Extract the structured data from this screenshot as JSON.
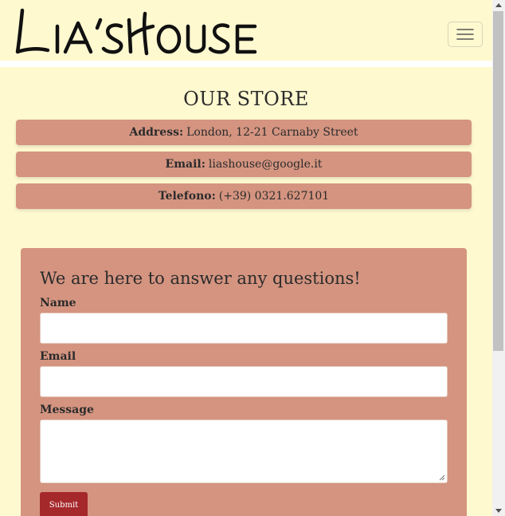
{
  "header": {
    "logo_text": "Lia's House",
    "menu_icon": "hamburger-menu-icon"
  },
  "store": {
    "title": "OUR STORE",
    "address_label": "Address:",
    "address_value": "London, 12-21 Carnaby Street",
    "email_label": "Email:",
    "email_value": "liashouse@google.it",
    "phone_label": "Telefono:",
    "phone_value": "(+39) 0321.627101"
  },
  "form": {
    "title": "We are here to answer any questions!",
    "name_label": "Name",
    "email_label": "Email",
    "message_label": "Message",
    "submit_label": "Submit"
  },
  "colors": {
    "background": "#fff9d0",
    "card": "#d49480",
    "button": "#a5282b"
  }
}
